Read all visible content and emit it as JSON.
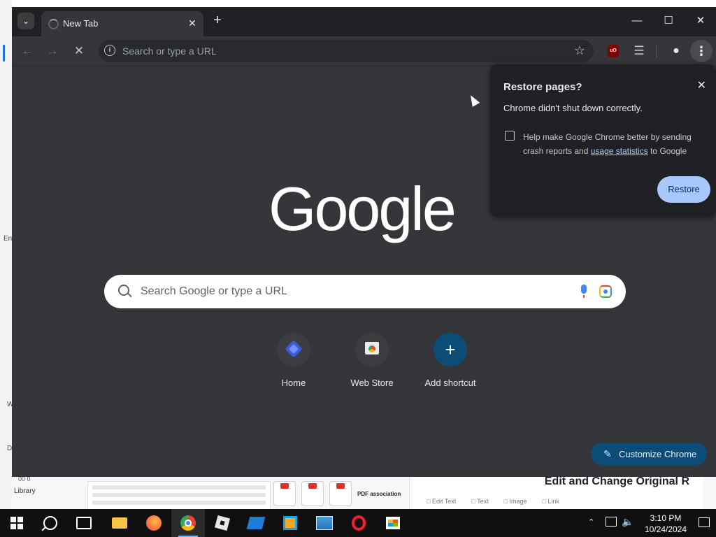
{
  "browser": {
    "tab_title": "New Tab",
    "url": "",
    "url_placeholder": "Search or type a URL"
  },
  "newtab": {
    "logo_text": "Google",
    "search_placeholder": "Search Google or type a URL",
    "shortcuts": [
      {
        "label": "Home",
        "icon": "home-icon"
      },
      {
        "label": "Web Store",
        "icon": "web-store-icon"
      },
      {
        "label": "Add shortcut",
        "icon": "plus-icon"
      }
    ],
    "customize_label": "Customize Chrome"
  },
  "restore_bubble": {
    "title": "Restore pages?",
    "message": "Chrome didn't shut down correctly.",
    "checkbox_text_before": "Help make Google Chrome better by sending crash reports and ",
    "checkbox_link": "usage statistics",
    "checkbox_text_after": " to Google",
    "checkbox_checked": false,
    "restore_label": "Restore"
  },
  "background": {
    "library_label": "Library",
    "count_label": "00 0",
    "pdf_assoc": "PDF association",
    "doc_heading": "Edit and Change Original R",
    "doc_tools": [
      "Edit Text",
      "Text",
      "Image",
      "Link"
    ],
    "side_fragments": [
      "En",
      "W",
      "D"
    ]
  },
  "taskbar": {
    "time": "3:10 PM",
    "date": "10/24/2024"
  },
  "colors": {
    "chrome_frame": "#202124",
    "chrome_surface": "#35363a",
    "accent_button": "#a8c7fa",
    "customize_button": "#0c4d78"
  }
}
